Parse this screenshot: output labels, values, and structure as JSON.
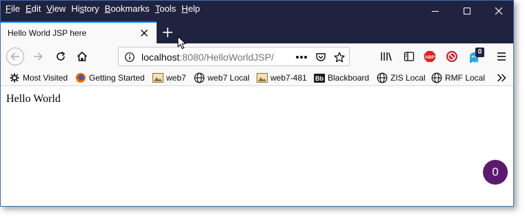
{
  "menu": {
    "items": [
      {
        "u": "F",
        "rest": "ile"
      },
      {
        "u": "E",
        "rest": "dit"
      },
      {
        "u": "V",
        "rest": "iew"
      },
      {
        "pre": "Hi",
        "u": "s",
        "rest": "tory"
      },
      {
        "u": "B",
        "rest": "ookmarks"
      },
      {
        "u": "T",
        "rest": "ools"
      },
      {
        "u": "H",
        "rest": "elp"
      }
    ]
  },
  "window_controls": {
    "minimize_icon": "minimize-icon",
    "maximize_icon": "maximize-icon",
    "close_icon": "close-icon"
  },
  "tab": {
    "title": "Hello World JSP here"
  },
  "navbar": {
    "url_host": "localhost",
    "url_rest": ":8080/HelloWorldJSP/",
    "notification_count": "0"
  },
  "bookmarks": [
    {
      "label": "Most Visited",
      "icon": "gear-icon"
    },
    {
      "label": "Getting Started",
      "icon": "firefox-icon"
    },
    {
      "label": "web7",
      "icon": "image-icon"
    },
    {
      "label": "web7 Local",
      "icon": "globe-icon"
    },
    {
      "label": "web7-481",
      "icon": "image-icon"
    },
    {
      "label": "Blackboard",
      "icon": "blackboard-icon"
    },
    {
      "label": "ZIS Local",
      "icon": "globe-icon"
    },
    {
      "label": "RMF Local",
      "icon": "globe-icon"
    }
  ],
  "content": {
    "text": "Hello World",
    "badge_count": "0"
  },
  "colors": {
    "titlebar": "#20233f",
    "tab_accent": "#0a84ff",
    "badge": "#5b1a6d"
  }
}
